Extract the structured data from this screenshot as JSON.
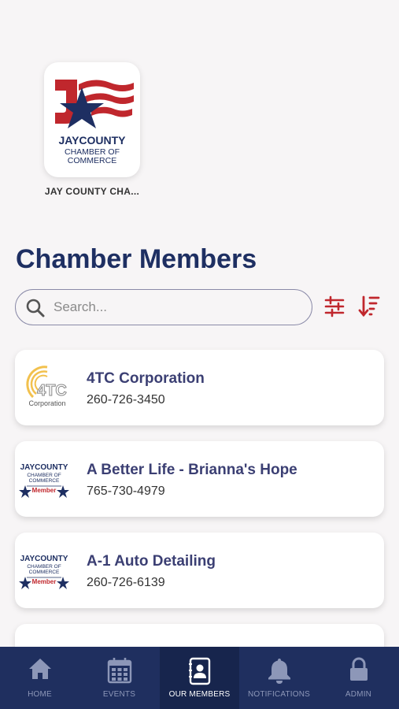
{
  "organization": {
    "logo_text": "JAY COUNTY CHAMBER OF COMMERCE",
    "name": "JAY COUNTY CHA..."
  },
  "page_title": "Chamber Members",
  "search": {
    "placeholder": "Search...",
    "value": ""
  },
  "controls": {
    "filter_icon": "sliders-icon",
    "sort_icon": "sort-descending-icon"
  },
  "members": [
    {
      "name": "4TC Corporation",
      "phone": "260-726-3450",
      "logo": "4TC Corporation"
    },
    {
      "name": "A Better Life - Brianna's Hope",
      "phone": "765-730-4979",
      "logo": "JAY COUNTY CHAMBER OF COMMERCE Member"
    },
    {
      "name": "A-1 Auto Detailing",
      "phone": "260-726-6139",
      "logo": "JAY COUNTY CHAMBER OF COMMERCE Member"
    }
  ],
  "tabs": [
    {
      "label": "HOME",
      "icon": "home-icon",
      "active": false
    },
    {
      "label": "EVENTS",
      "icon": "calendar-icon",
      "active": false
    },
    {
      "label": "OUR MEMBERS",
      "icon": "contacts-icon",
      "active": true
    },
    {
      "label": "NOTIFICATIONS",
      "icon": "bell-icon",
      "active": false
    },
    {
      "label": "ADMIN",
      "icon": "lock-icon",
      "active": false
    }
  ],
  "colors": {
    "primary_navy": "#1e2f62",
    "accent_red": "#c0272d",
    "tabbar": "#1f2f5f"
  }
}
